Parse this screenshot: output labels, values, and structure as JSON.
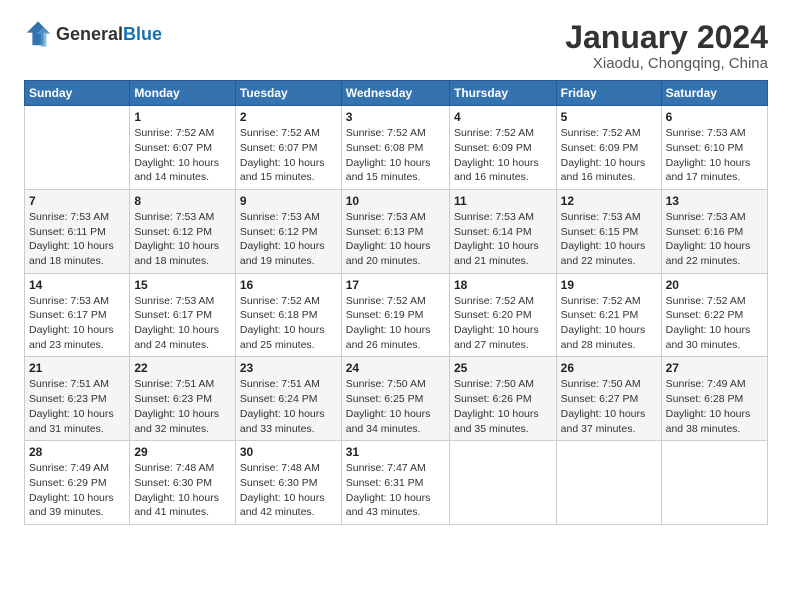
{
  "logo": {
    "general": "General",
    "blue": "Blue"
  },
  "title": "January 2024",
  "subtitle": "Xiaodu, Chongqing, China",
  "weekdays": [
    "Sunday",
    "Monday",
    "Tuesday",
    "Wednesday",
    "Thursday",
    "Friday",
    "Saturday"
  ],
  "weeks": [
    [
      {
        "day": "",
        "sunrise": "",
        "sunset": "",
        "daylight": ""
      },
      {
        "day": "1",
        "sunrise": "Sunrise: 7:52 AM",
        "sunset": "Sunset: 6:07 PM",
        "daylight": "Daylight: 10 hours and 14 minutes."
      },
      {
        "day": "2",
        "sunrise": "Sunrise: 7:52 AM",
        "sunset": "Sunset: 6:07 PM",
        "daylight": "Daylight: 10 hours and 15 minutes."
      },
      {
        "day": "3",
        "sunrise": "Sunrise: 7:52 AM",
        "sunset": "Sunset: 6:08 PM",
        "daylight": "Daylight: 10 hours and 15 minutes."
      },
      {
        "day": "4",
        "sunrise": "Sunrise: 7:52 AM",
        "sunset": "Sunset: 6:09 PM",
        "daylight": "Daylight: 10 hours and 16 minutes."
      },
      {
        "day": "5",
        "sunrise": "Sunrise: 7:52 AM",
        "sunset": "Sunset: 6:09 PM",
        "daylight": "Daylight: 10 hours and 16 minutes."
      },
      {
        "day": "6",
        "sunrise": "Sunrise: 7:53 AM",
        "sunset": "Sunset: 6:10 PM",
        "daylight": "Daylight: 10 hours and 17 minutes."
      }
    ],
    [
      {
        "day": "7",
        "sunrise": "Sunrise: 7:53 AM",
        "sunset": "Sunset: 6:11 PM",
        "daylight": "Daylight: 10 hours and 18 minutes."
      },
      {
        "day": "8",
        "sunrise": "Sunrise: 7:53 AM",
        "sunset": "Sunset: 6:12 PM",
        "daylight": "Daylight: 10 hours and 18 minutes."
      },
      {
        "day": "9",
        "sunrise": "Sunrise: 7:53 AM",
        "sunset": "Sunset: 6:12 PM",
        "daylight": "Daylight: 10 hours and 19 minutes."
      },
      {
        "day": "10",
        "sunrise": "Sunrise: 7:53 AM",
        "sunset": "Sunset: 6:13 PM",
        "daylight": "Daylight: 10 hours and 20 minutes."
      },
      {
        "day": "11",
        "sunrise": "Sunrise: 7:53 AM",
        "sunset": "Sunset: 6:14 PM",
        "daylight": "Daylight: 10 hours and 21 minutes."
      },
      {
        "day": "12",
        "sunrise": "Sunrise: 7:53 AM",
        "sunset": "Sunset: 6:15 PM",
        "daylight": "Daylight: 10 hours and 22 minutes."
      },
      {
        "day": "13",
        "sunrise": "Sunrise: 7:53 AM",
        "sunset": "Sunset: 6:16 PM",
        "daylight": "Daylight: 10 hours and 22 minutes."
      }
    ],
    [
      {
        "day": "14",
        "sunrise": "Sunrise: 7:53 AM",
        "sunset": "Sunset: 6:17 PM",
        "daylight": "Daylight: 10 hours and 23 minutes."
      },
      {
        "day": "15",
        "sunrise": "Sunrise: 7:53 AM",
        "sunset": "Sunset: 6:17 PM",
        "daylight": "Daylight: 10 hours and 24 minutes."
      },
      {
        "day": "16",
        "sunrise": "Sunrise: 7:52 AM",
        "sunset": "Sunset: 6:18 PM",
        "daylight": "Daylight: 10 hours and 25 minutes."
      },
      {
        "day": "17",
        "sunrise": "Sunrise: 7:52 AM",
        "sunset": "Sunset: 6:19 PM",
        "daylight": "Daylight: 10 hours and 26 minutes."
      },
      {
        "day": "18",
        "sunrise": "Sunrise: 7:52 AM",
        "sunset": "Sunset: 6:20 PM",
        "daylight": "Daylight: 10 hours and 27 minutes."
      },
      {
        "day": "19",
        "sunrise": "Sunrise: 7:52 AM",
        "sunset": "Sunset: 6:21 PM",
        "daylight": "Daylight: 10 hours and 28 minutes."
      },
      {
        "day": "20",
        "sunrise": "Sunrise: 7:52 AM",
        "sunset": "Sunset: 6:22 PM",
        "daylight": "Daylight: 10 hours and 30 minutes."
      }
    ],
    [
      {
        "day": "21",
        "sunrise": "Sunrise: 7:51 AM",
        "sunset": "Sunset: 6:23 PM",
        "daylight": "Daylight: 10 hours and 31 minutes."
      },
      {
        "day": "22",
        "sunrise": "Sunrise: 7:51 AM",
        "sunset": "Sunset: 6:23 PM",
        "daylight": "Daylight: 10 hours and 32 minutes."
      },
      {
        "day": "23",
        "sunrise": "Sunrise: 7:51 AM",
        "sunset": "Sunset: 6:24 PM",
        "daylight": "Daylight: 10 hours and 33 minutes."
      },
      {
        "day": "24",
        "sunrise": "Sunrise: 7:50 AM",
        "sunset": "Sunset: 6:25 PM",
        "daylight": "Daylight: 10 hours and 34 minutes."
      },
      {
        "day": "25",
        "sunrise": "Sunrise: 7:50 AM",
        "sunset": "Sunset: 6:26 PM",
        "daylight": "Daylight: 10 hours and 35 minutes."
      },
      {
        "day": "26",
        "sunrise": "Sunrise: 7:50 AM",
        "sunset": "Sunset: 6:27 PM",
        "daylight": "Daylight: 10 hours and 37 minutes."
      },
      {
        "day": "27",
        "sunrise": "Sunrise: 7:49 AM",
        "sunset": "Sunset: 6:28 PM",
        "daylight": "Daylight: 10 hours and 38 minutes."
      }
    ],
    [
      {
        "day": "28",
        "sunrise": "Sunrise: 7:49 AM",
        "sunset": "Sunset: 6:29 PM",
        "daylight": "Daylight: 10 hours and 39 minutes."
      },
      {
        "day": "29",
        "sunrise": "Sunrise: 7:48 AM",
        "sunset": "Sunset: 6:30 PM",
        "daylight": "Daylight: 10 hours and 41 minutes."
      },
      {
        "day": "30",
        "sunrise": "Sunrise: 7:48 AM",
        "sunset": "Sunset: 6:30 PM",
        "daylight": "Daylight: 10 hours and 42 minutes."
      },
      {
        "day": "31",
        "sunrise": "Sunrise: 7:47 AM",
        "sunset": "Sunset: 6:31 PM",
        "daylight": "Daylight: 10 hours and 43 minutes."
      },
      {
        "day": "",
        "sunrise": "",
        "sunset": "",
        "daylight": ""
      },
      {
        "day": "",
        "sunrise": "",
        "sunset": "",
        "daylight": ""
      },
      {
        "day": "",
        "sunrise": "",
        "sunset": "",
        "daylight": ""
      }
    ]
  ]
}
